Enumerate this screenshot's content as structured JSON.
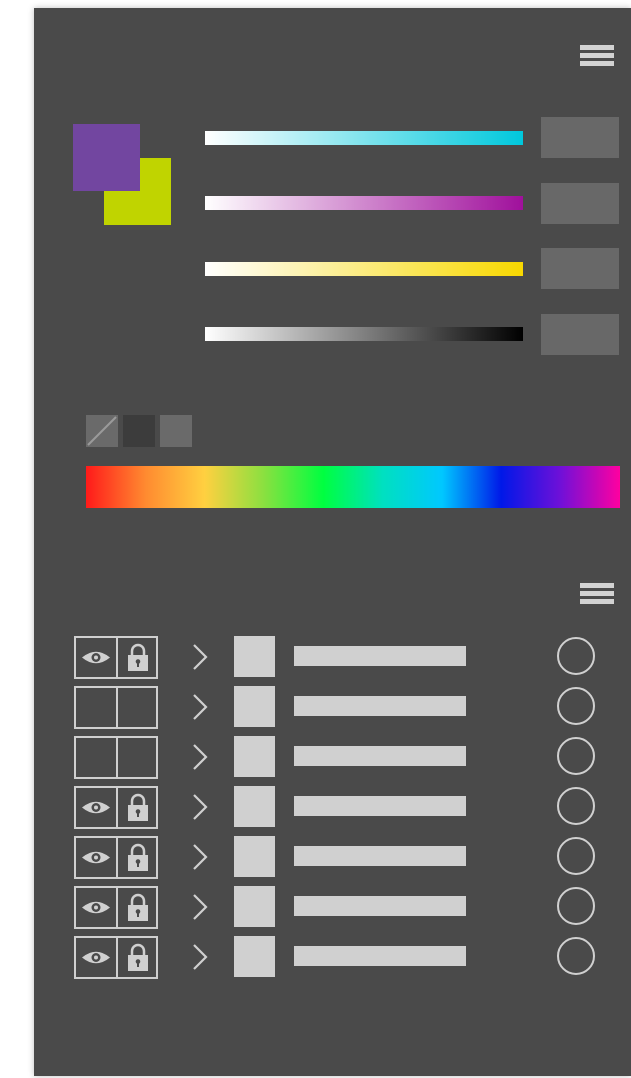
{
  "panel_background": "#4a4a4a",
  "color_panel": {
    "menu_icon": "hamburger-menu-icon",
    "primary_color": "#7246a0",
    "secondary_color": "#c0d400",
    "sliders": [
      {
        "channel": "cyan",
        "gradient": [
          "#ffffff",
          "#00c8dc"
        ],
        "value": ""
      },
      {
        "channel": "magenta",
        "gradient": [
          "#ffffff",
          "#a0109c"
        ],
        "value": ""
      },
      {
        "channel": "yellow",
        "gradient": [
          "#ffffff",
          "#f8d800"
        ],
        "value": ""
      },
      {
        "channel": "black",
        "gradient": [
          "#ffffff",
          "#000000"
        ],
        "value": ""
      }
    ],
    "mode_buttons": [
      {
        "name": "none-color-icon"
      },
      {
        "name": "dark-swatch"
      },
      {
        "name": "light-swatch"
      }
    ],
    "spectrum_colors": [
      "#ff1a1a",
      "#ff8a30",
      "#ffd040",
      "#8ae040",
      "#00ff40",
      "#00e0c0",
      "#00c8ff",
      "#0018e8",
      "#7010d8",
      "#ff00a0"
    ]
  },
  "layers_panel": {
    "menu_icon": "hamburger-menu-icon",
    "rows": [
      {
        "visible": true,
        "locked": true
      },
      {
        "visible": false,
        "locked": false
      },
      {
        "visible": false,
        "locked": false
      },
      {
        "visible": true,
        "locked": true
      },
      {
        "visible": true,
        "locked": true
      },
      {
        "visible": true,
        "locked": true
      },
      {
        "visible": true,
        "locked": true
      }
    ]
  }
}
